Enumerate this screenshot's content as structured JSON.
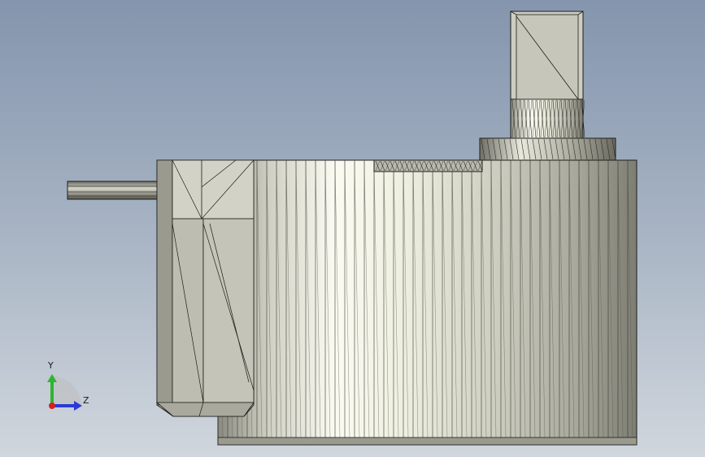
{
  "viewport": {
    "background_top": "#8495ad",
    "background_bottom": "#d0d6dd"
  },
  "model": {
    "body_color": "#d8d8cc",
    "highlight_color": "#fbfbf2",
    "shadow_color": "#6e6e64",
    "edge_color": "#1e1e1a"
  },
  "triad": {
    "y_label": "Y",
    "z_label": "Z",
    "y_color": "#2fb52f",
    "z_color": "#2a3ad6",
    "x_color": "#d62020"
  }
}
